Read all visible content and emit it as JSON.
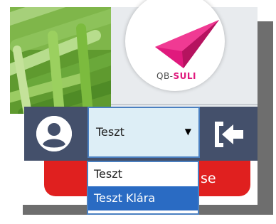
{
  "logo": {
    "prefix": "QB-",
    "brand": "SULI",
    "brand_color": "#e0197d"
  },
  "user_select": {
    "current_value": "Teszt",
    "arrow": "▼"
  },
  "user_dropdown": {
    "options": [
      {
        "label": "Teszt",
        "highlighted": false
      },
      {
        "label": "Teszt Klára",
        "highlighted": true
      }
    ]
  },
  "red_button": {
    "label_visible_fragment": "se",
    "icon": "trash-icon",
    "color": "#e0201f"
  },
  "icons": {
    "user": "user-circle-icon",
    "logout": "logout-arrow-icon"
  },
  "colors": {
    "toolbar": "#44506b",
    "select_bg": "#ddeef6",
    "selected_option": "#2a6bc3"
  }
}
